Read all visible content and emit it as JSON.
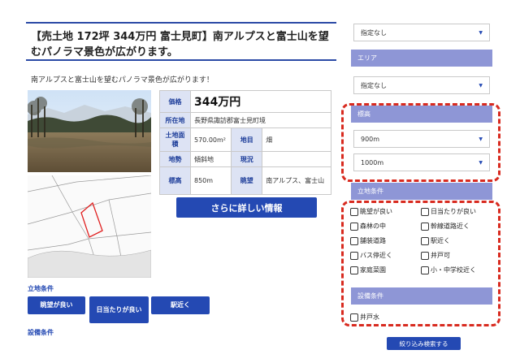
{
  "listing": {
    "title": "【売土地 172坪 344万円 富士見町】南アルプスと富士山を望むパノラマ景色が広がります。",
    "lead": "南アルプスと富士山を望むパノラマ景色が広がります！",
    "spec": {
      "price_label": "価格",
      "price": "344万円",
      "location_label": "所在地",
      "location": "長野県諏訪郡富士見町境",
      "area_label": "土地面積",
      "area": "570.00m²",
      "category_label": "地目",
      "category": "畑",
      "terrain_label": "地勢",
      "terrain": "傾斜地",
      "status_label": "現況",
      "status": "",
      "altitude_label": "標高",
      "altitude": "850m",
      "view_label": "眺望",
      "view": "南アルプス、富士山"
    },
    "detail_button": "さらに詳しい情報",
    "conditions_heading": "立地条件",
    "condition_tags": [
      "眺望が良い",
      "日当たりが良い",
      "駅近く"
    ],
    "facilities_heading": "設備条件"
  },
  "sidebar": {
    "select_top": "指定なし",
    "area_heading": "エリア",
    "area_select": "指定なし",
    "altitude_heading": "標高",
    "altitude_min": "900m",
    "altitude_max": "1000m",
    "location_heading": "立地条件",
    "location_options": [
      "眺望が良い",
      "日当たりが良い",
      "森林の中",
      "幹線道路近く",
      "舗装道路",
      "駅近く",
      "バス停近く",
      "井戸可",
      "家庭菜園",
      "小・中学校近く"
    ],
    "facility_heading": "設備条件",
    "facility_options": [
      "井戸水"
    ],
    "search_button": "絞り込み検索する"
  },
  "colors": {
    "accent": "#2449b3",
    "header_purple": "#8e96d6",
    "highlight": "#d82a1f"
  }
}
